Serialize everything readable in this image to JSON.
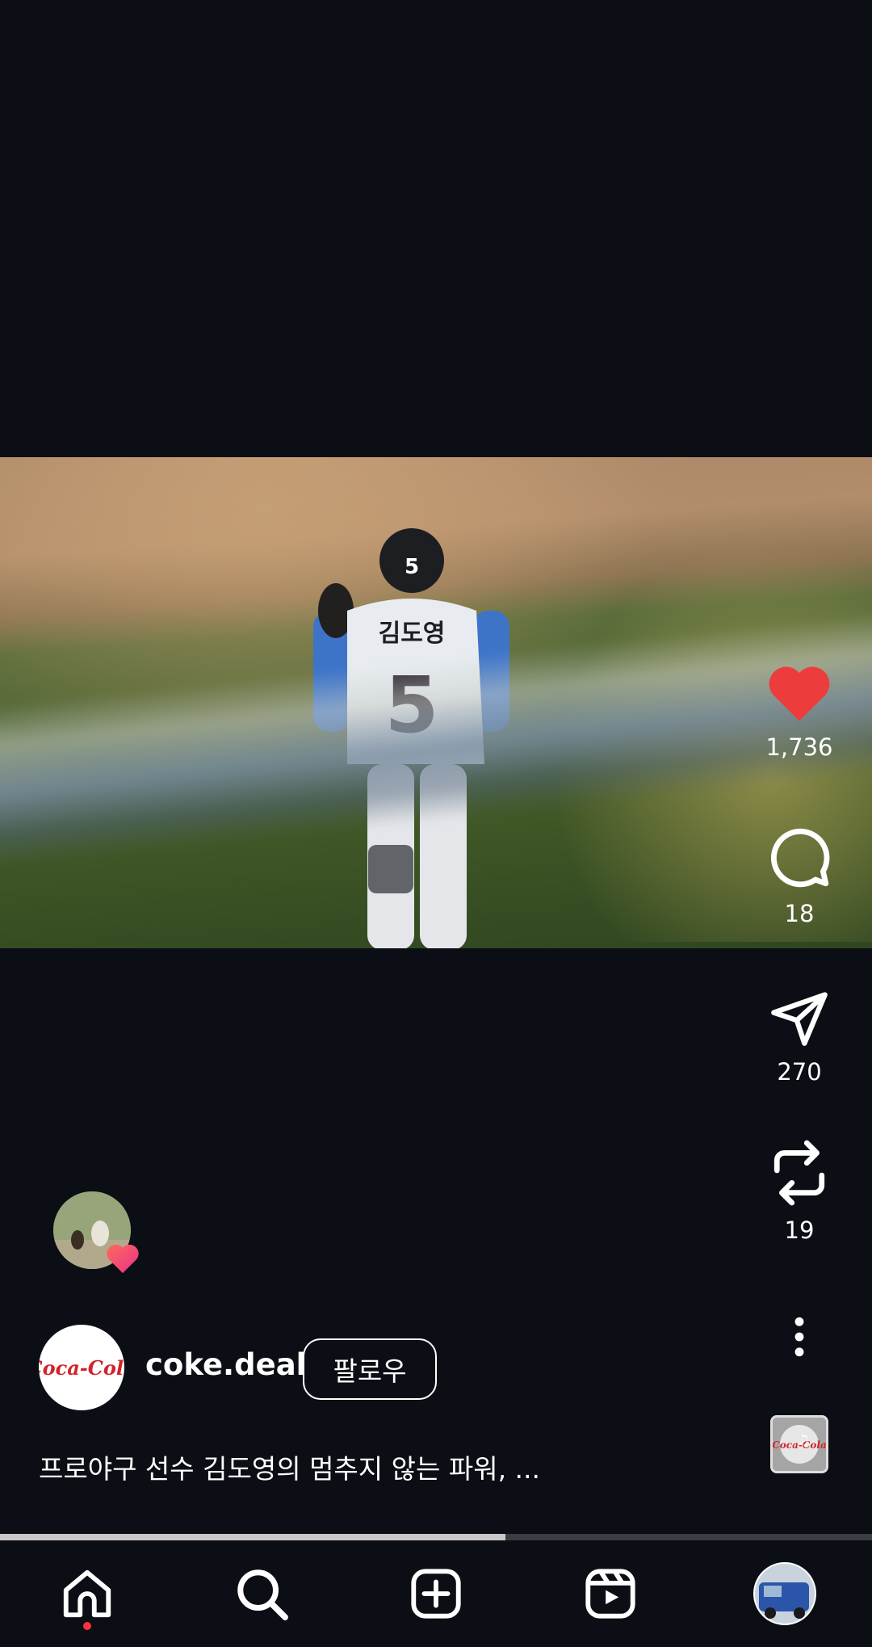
{
  "post": {
    "username": "coke.deal",
    "follow_label": "팔로우",
    "caption": "프로야구 선수 김도영의 멈추지 않는 파워, ...",
    "player_name": "김도영",
    "player_number": "5",
    "brand_logo_text": "Coca-Cola"
  },
  "actions": {
    "likes": "1,736",
    "comments": "18",
    "shares": "270",
    "reposts": "19",
    "liked": true
  },
  "progress": {
    "fraction": 0.58
  },
  "nav": {
    "items": [
      "home-icon",
      "search-icon",
      "create-icon",
      "reels-icon",
      "profile-avatar"
    ],
    "active": "home-icon"
  },
  "colors": {
    "background": "#0b0e14",
    "like": "#ed3c3c",
    "badge": "#ff3040"
  }
}
